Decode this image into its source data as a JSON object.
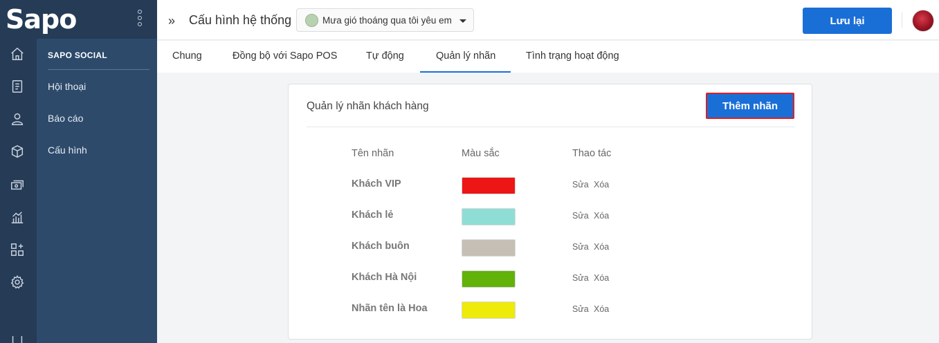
{
  "brand": {
    "logo_text": "Sapo"
  },
  "rail": {
    "icons": [
      "home-icon",
      "orders-icon",
      "customer-icon",
      "product-icon",
      "cashbook-icon",
      "report-icon",
      "apps-icon",
      "settings-icon"
    ]
  },
  "subnav": {
    "title": "SAPO SOCIAL",
    "items": [
      {
        "label": "Hội thoại"
      },
      {
        "label": "Báo cáo"
      },
      {
        "label": "Cấu hình"
      }
    ]
  },
  "header": {
    "title": "Cấu hình hệ thống",
    "page_select": "Mưa gió thoáng qua tôi yêu em",
    "save_label": "Lưu lại"
  },
  "tabs": [
    {
      "label": "Chung"
    },
    {
      "label": "Đồng bộ với Sapo POS"
    },
    {
      "label": "Tự động"
    },
    {
      "label": "Quản lý nhãn"
    },
    {
      "label": "Tình trạng hoạt động"
    }
  ],
  "active_tab": "Quản lý nhãn",
  "card": {
    "title": "Quản lý nhãn khách hàng",
    "add_label": "Thêm nhãn",
    "columns": [
      "Tên nhãn",
      "Màu sắc",
      "Thao tác"
    ],
    "rows": [
      {
        "name": "Khách VIP",
        "color": "#ee1515",
        "edit": "Sửa",
        "delete": "Xóa"
      },
      {
        "name": "Khách lẻ",
        "color": "#8fded6",
        "edit": "Sửa",
        "delete": "Xóa"
      },
      {
        "name": "Khách buôn",
        "color": "#c5bfb6",
        "edit": "Sửa",
        "delete": "Xóa"
      },
      {
        "name": "Khách Hà Nội",
        "color": "#62b20a",
        "edit": "Sửa",
        "delete": "Xóa"
      },
      {
        "name": "Nhãn tên là Hoa",
        "color": "#eeea0a",
        "edit": "Sửa",
        "delete": "Xóa"
      }
    ]
  },
  "colors": {
    "sidebar_dark": "#253b56",
    "sidebar": "#2d4a6b",
    "primary": "#1a6fd6",
    "highlight_border": "#e01e24"
  }
}
